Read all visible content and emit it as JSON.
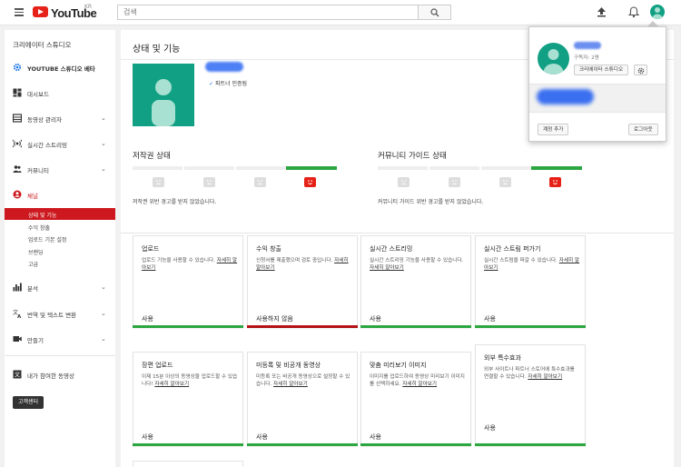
{
  "header": {
    "logo_text": "YouTube",
    "region": "KR",
    "search_placeholder": "검색"
  },
  "sidebar": {
    "title": "크리에이터 스튜디오",
    "items": [
      {
        "label": "YOUTUBE 스튜디오 베타",
        "icon": "gear-icon"
      },
      {
        "label": "대시보드",
        "icon": "dashboard-icon"
      },
      {
        "label": "동영상 관리자",
        "icon": "video-manager-icon"
      },
      {
        "label": "실시간 스트리밍",
        "icon": "live-icon"
      },
      {
        "label": "커뮤니티",
        "icon": "community-icon"
      },
      {
        "label": "채널",
        "icon": "channel-icon"
      },
      {
        "label": "분석",
        "icon": "analytics-icon"
      },
      {
        "label": "번역 및 텍스트 변환",
        "icon": "translate-icon"
      },
      {
        "label": "만들기",
        "icon": "create-icon"
      },
      {
        "label": "내가 참여한 동영상",
        "icon": "contributions-icon"
      }
    ],
    "channel_subitems": [
      "상태 및 기능",
      "수익 창출",
      "업로드 기본 설정",
      "브랜딩",
      "고급"
    ],
    "help_button": "고객센터"
  },
  "main": {
    "page_title": "상태 및 기능",
    "partner_verified": "파트너 인증됨",
    "copyright": {
      "title": "저작권 상태",
      "message": "저작권 위반 경고를 받지 않았습니다."
    },
    "community": {
      "title": "커뮤니티 가이드 상태",
      "message": "커뮤니티 가이드 위반 경고를 받지 않았습니다."
    },
    "cards": [
      {
        "title": "업로드",
        "desc": "업로드 기능을 사용할 수 있습니다. ",
        "link": "자세히 알아보기",
        "status": "사용",
        "state": "enabled"
      },
      {
        "title": "수익 창출",
        "desc": "신청서를 제출했으며 검토 중입니다. ",
        "link": "자세히 알아보기",
        "status": "사용하지 않음",
        "state": "disabled"
      },
      {
        "title": "실시간 스트리밍",
        "desc": "실시간 스트리밍 기능을 사용할 수 있습니다. ",
        "link": "자세히 알아보기",
        "status": "사용",
        "state": "enabled"
      },
      {
        "title": "실시간 스트림 퍼가기",
        "desc": "실시간 스트림을 퍼갈 수 있습니다. ",
        "link": "자세히 알아보기",
        "status": "사용",
        "state": "enabled"
      },
      {
        "title": "장편 업로드",
        "desc": "이제 15분 이상의 동영상을 업로드할 수 있습니다! ",
        "link": "자세히 알아보기",
        "status": "사용",
        "state": "enabled"
      },
      {
        "title": "미등록 및 비공개 동영상",
        "desc": "미등록 또는 비공개 동영상으로 설정할 수 있습니다. ",
        "link": "자세히 알아보기",
        "status": "사용",
        "state": "enabled"
      },
      {
        "title": "맞춤 미리보기 이미지",
        "desc": "이미지를 업로드하여 동영상 미리보기 이미지를 선택하세요. ",
        "link": "자세히 알아보기",
        "status": "사용",
        "state": "enabled"
      },
      {
        "title": "외부 특수효과",
        "desc": "외부 사이트나 파트너 스토어에 특수효과를 연결할 수 있습니다. ",
        "link": "자세히 알아보기",
        "status": "사용",
        "state": "enabled"
      }
    ]
  },
  "account_popup": {
    "subscribers": "구독자: 2명",
    "studio_button": "크리에이터 스튜디오",
    "add_account": "계정 추가",
    "logout": "로그아웃"
  },
  "colors": {
    "accent_red": "#cc181e",
    "enabled_green": "#2ba640",
    "disabled_red": "#b31217",
    "avatar_teal": "#11a083"
  }
}
